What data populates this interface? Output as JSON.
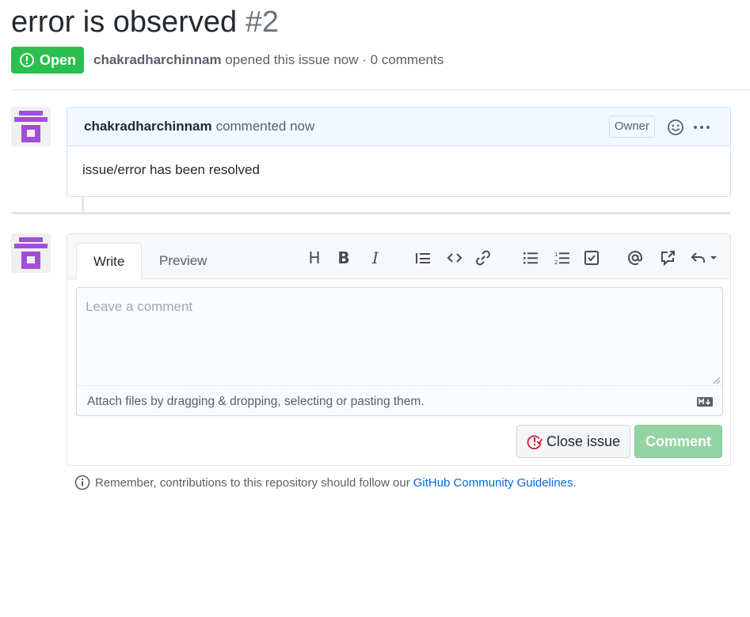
{
  "issue": {
    "title": "error is observed",
    "number": "#2",
    "state_label": "Open",
    "author": "chakradharchinnam",
    "opened_text": "opened this issue now · 0 comments"
  },
  "comment": {
    "author": "chakradharchinnam",
    "time_text": "commented now",
    "owner_badge": "Owner",
    "body": "issue/error has been resolved"
  },
  "editor": {
    "tabs": {
      "write": "Write",
      "preview": "Preview"
    },
    "toolbar": {
      "heading": "H",
      "bold": "B",
      "italic": "I",
      "icons": [
        "quote-icon",
        "code-icon",
        "link-icon",
        "bullet-list-icon",
        "numbered-list-icon",
        "task-list-icon",
        "mention-icon",
        "reference-icon",
        "reply-icon"
      ]
    },
    "placeholder": "Leave a comment",
    "attach_text": "Attach files by dragging & dropping, selecting or pasting them."
  },
  "actions": {
    "close_issue": "Close issue",
    "comment": "Comment"
  },
  "footer": {
    "text": "Remember, contributions to this repository should follow our",
    "link": "GitHub Community Guidelines",
    "period": "."
  },
  "colors": {
    "open_green": "#2cbe4e",
    "avatar_purple": "#a24ed8",
    "link_blue": "#0366d6",
    "close_red": "#cb2431"
  }
}
